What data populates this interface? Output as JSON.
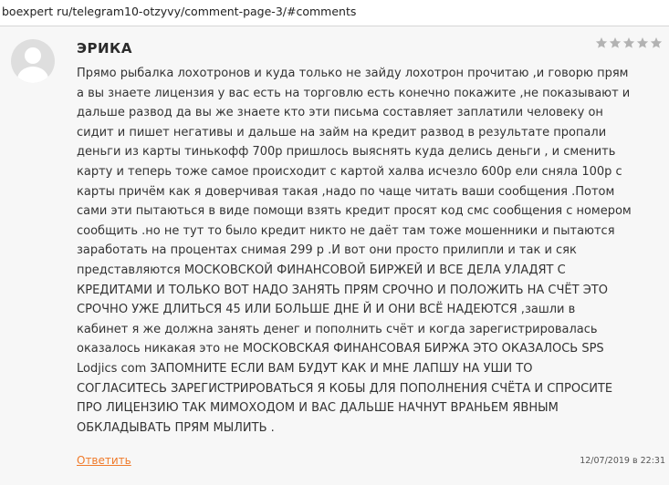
{
  "address_bar": {
    "url": "boexpert ru/telegram10-otzyvy/comment-page-3/#comments"
  },
  "comment": {
    "author": "ЭРИКА",
    "rating": {
      "stars_filled": 5,
      "stars_total": 5,
      "star_color": "#b3b3b3"
    },
    "body_lines": [
      "Прямо рыбалка лохотронов и куда только не зайду лохотрон прочитаю ,и говорю прям",
      "а вы знаете лицензия у вас есть на торговлю есть конечно покажите ,не показывают и",
      "дальше развод да вы же знаете кто эти письма составляет заплатили человеку он",
      "сидит и пишет негативы и дальше на займ на кредит развод в результате пропали",
      "деньги из карты тинькофф 700р пришлось выяснять куда делись деньги , и сменить",
      "карту и теперь тоже самое происходит с картой халва исчезло 600р ели сняла 100р с",
      "карты причём как я доверчивая такая ,надо по чаще читать ваши сообщения .Потом",
      "сами эти пытаються в виде помощи взять кредит просят код смс сообщения с номером",
      "сообщить .но не тут то было кредит никто не даёт там тоже мошенники и пытаются",
      "заработать на процентах снимая 299 р .И вот они просто прилипли и так и сяк",
      "представляются МОСКОВСКОЙ ФИНАНСОВОЙ БИРЖЕЙ И ВСЕ ДЕЛА УЛАДЯТ С",
      "КРЕДИТАМИ И ТОЛЬКО ВОТ НАДО ЗАНЯТЬ ПРЯМ СРОЧНО И ПОЛОЖИТЬ НА СЧЁТ ЭТО",
      "СРОЧНО УЖЕ ДЛИТЬСЯ 45 ИЛИ БОЛЬШЕ ДНЕ Й И ОНИ ВСЁ НАДЕЮТСЯ ,зашли в",
      "кабинет я же должна занять денег и пополнить счёт и когда зарегистрировалась",
      "оказалось никакая это не МОСКОВСКАЯ ФИНАНСОВАЯ БИРЖА ЭТО ОКАЗАЛОСЬ SPS",
      "Lodjics com ЗАПОМНИТЕ ЕСЛИ ВАМ БУДУТ КАК И МНЕ ЛАПШУ НА УШИ ТО",
      "СОГЛАСИТЕСЬ ЗАРЕГИСТРИРОВАТЬСЯ Я КОБЫ ДЛЯ ПОПОЛНЕНИЯ СЧЁТА И СПРОСИТЕ",
      "ПРО ЛИЦЕНЗИЮ ТАК МИМОХОДОМ И ВАС ДАЛЬШЕ НАЧНУТ ВРАНЬЕМ ЯВНЫМ",
      "ОБКЛАДЫВАТЬ ПРЯМ МЫЛИТЬ ."
    ],
    "reply_label": "Ответить",
    "date": "12/07/2019 в 22:31"
  },
  "colors": {
    "comment_background": "#f7f7f7",
    "reply_link": "#f07a2a",
    "avatar_bg": "#dedede",
    "avatar_fg": "#ffffff"
  }
}
